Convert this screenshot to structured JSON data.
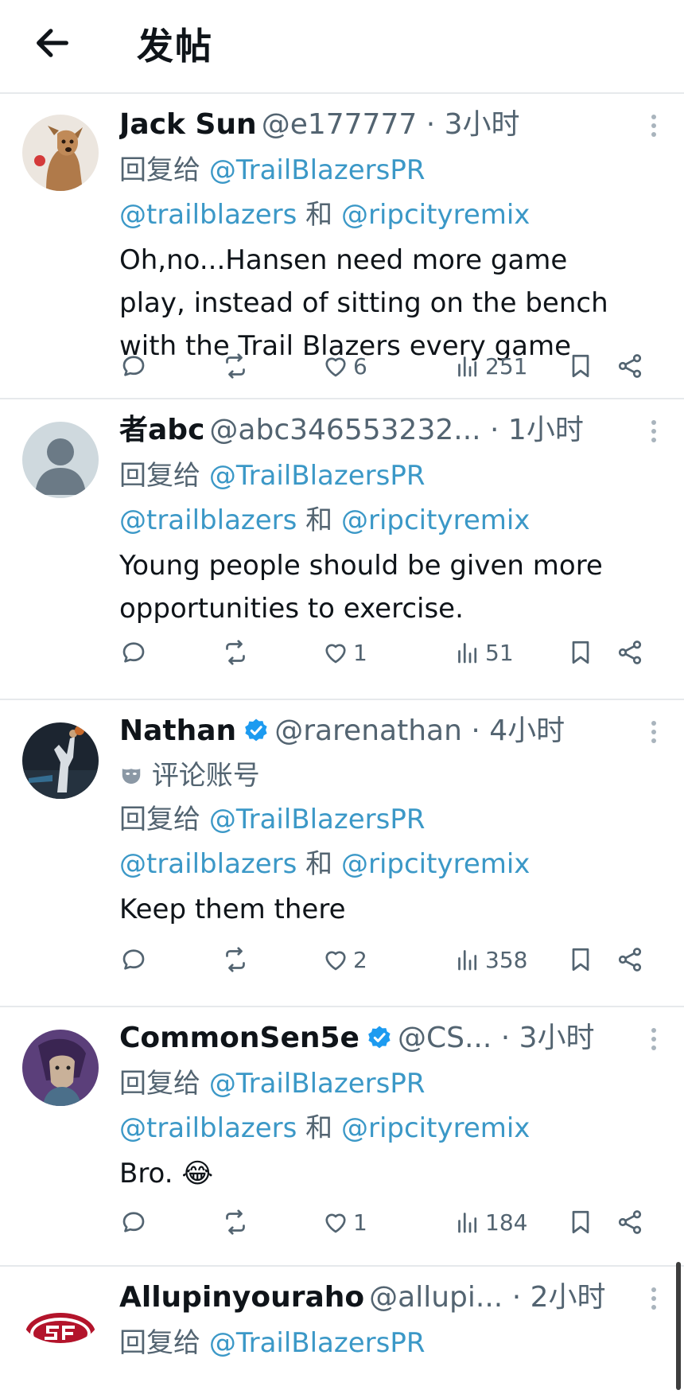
{
  "header": {
    "title": "发帖",
    "back_icon": "arrow-left-icon"
  },
  "reply_to_label": "回复给",
  "and_label": "和",
  "posts": [
    {
      "name": "Jack Sun",
      "verified": false,
      "handle": "@e177777",
      "time": "· 3小时",
      "mentions": [
        "@TrailBlazersPR",
        "@trailblazers",
        "@ripcityremix"
      ],
      "lines": [
        "Oh,no...Hansen need more game",
        "play, instead of sitting on the bench",
        "with the Trail Blazers every game"
      ],
      "likes": "6",
      "views": "251",
      "avatar": "dog-photo"
    },
    {
      "name": "者abc",
      "verified": false,
      "handle": "@abc346553232...",
      "time": "· 1小时",
      "mentions": [
        "@TrailBlazersPR",
        "@trailblazers",
        "@ripcityremix"
      ],
      "lines": [
        "Young people should be given more",
        "opportunities to exercise."
      ],
      "likes": "1",
      "views": "51",
      "avatar": "default-avatar"
    },
    {
      "name": "Nathan",
      "verified": true,
      "handle": "@rarenathan",
      "time": "· 4小时",
      "label": "评论账号",
      "mentions": [
        "@TrailBlazersPR",
        "@trailblazers",
        "@ripcityremix"
      ],
      "lines": [
        "Keep them there"
      ],
      "likes": "2",
      "views": "358",
      "avatar": "basketball-player-photo"
    },
    {
      "name": "CommonSen5e",
      "verified": true,
      "handle": "@CS...",
      "time": "· 3小时",
      "mentions": [
        "@TrailBlazersPR",
        "@trailblazers",
        "@ripcityremix"
      ],
      "lines": [
        "Bro. 😂"
      ],
      "likes": "1",
      "views": "184",
      "avatar": "anime-photo"
    },
    {
      "name": "Allupinyouraho",
      "verified": false,
      "handle": "@allupi...",
      "time": "· 2小时",
      "mentions": [
        "@TrailBlazersPR"
      ],
      "avatar": "49ers-logo"
    }
  ],
  "colors": {
    "link": "#3b98c7",
    "muted": "#536471",
    "verified": "#1d9bf0",
    "divider": "#e6e9ec"
  }
}
